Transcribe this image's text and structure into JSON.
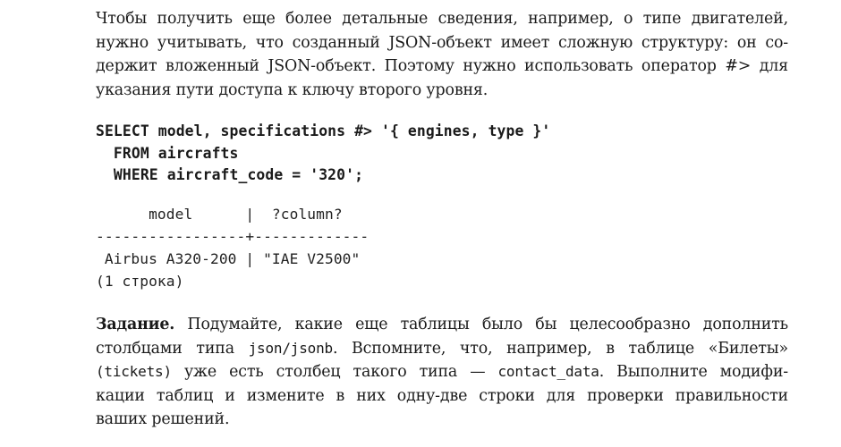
{
  "intro": {
    "lines": [
      "Чтобы получить еще более детальные сведения, например, о типе двигателей,",
      "нужно учитывать, что созданный JSON-объект имеет сложную структуру: он со-",
      "держит вложенный JSON-объект. Поэтому нужно использовать оператор #> для",
      "указания пути доступа к ключу второго уровня."
    ]
  },
  "code": {
    "lines": [
      "SELECT model, specifications #> '{ engines, type }'",
      "  FROM aircrafts",
      "  WHERE aircraft_code = '320';"
    ]
  },
  "output": {
    "header": "      model      |  ?column?",
    "separator": "-----------------+-------------",
    "row": " Airbus A320-200 | \"IAE V2500\"",
    "footer": "(1 строка)"
  },
  "task": {
    "label": "Задание.",
    "line1_text": " Подумайте, какие еще таблицы было бы целесообразно дополнить",
    "line2_pre": "столбцами типа ",
    "line2_code": "json/jsonb",
    "line2_post": ". Вспомните, что, например, в таблице «Билеты»",
    "line3_code1": "(tickets)",
    "line3_mid": " уже есть столбец такого типа — ",
    "line3_code2": "contact_data",
    "line3_post": ". Выполните модифи-",
    "line4": "кации таблиц и измените в них одну-две строки для проверки правильности",
    "line5": "ваших решений."
  }
}
